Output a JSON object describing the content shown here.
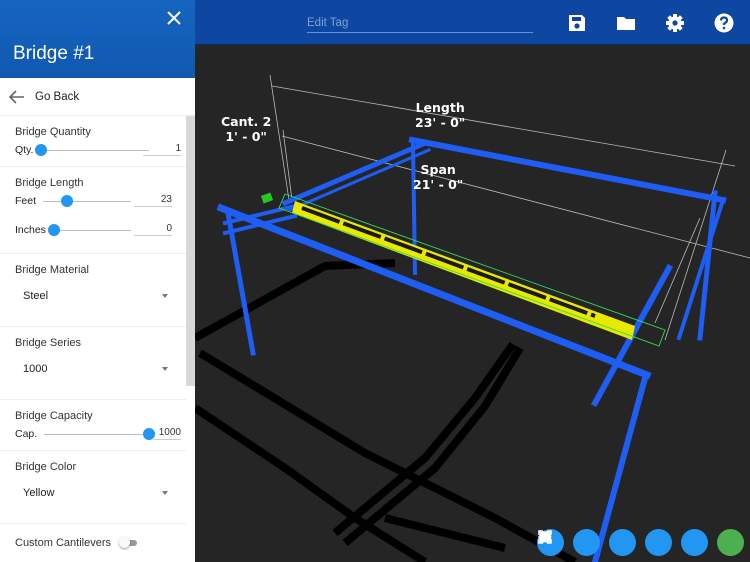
{
  "sidebar": {
    "title": "Bridge #1",
    "close_icon": "close-icon",
    "go_back": "Go Back",
    "sections": {
      "quantity": {
        "title": "Bridge Quantity",
        "label": "Qty.",
        "value": "1",
        "fraction": 0.0
      },
      "length": {
        "title": "Bridge Length",
        "feet": {
          "label": "Feet",
          "value": "23",
          "fraction": 0.22
        },
        "inches": {
          "label": "Inches",
          "value": "0",
          "fraction": 0.0
        }
      },
      "material": {
        "title": "Bridge Material",
        "selected": "Steel"
      },
      "series": {
        "title": "Bridge Series",
        "selected": "1000"
      },
      "capacity": {
        "title": "Bridge Capacity",
        "label": "Cap.",
        "value": "1000",
        "fraction": 1.0
      },
      "color": {
        "title": "Bridge Color",
        "selected": "Yellow"
      },
      "cantilevers": {
        "label": "Custom Cantilevers",
        "enabled": false
      }
    }
  },
  "topbar": {
    "tag_placeholder": "Edit Tag",
    "icons": [
      "save-icon",
      "folder-icon",
      "settings-icon",
      "help-icon"
    ]
  },
  "viewport": {
    "dimensions": {
      "cant2": {
        "name": "Cant. 2",
        "value": "1' - 0\""
      },
      "length": {
        "name": "Length",
        "value": "23' - 0\""
      },
      "span": {
        "name": "Span",
        "value": "21' - 0\""
      }
    },
    "colors": {
      "frame": "#1e5ef5",
      "bridge": "#ffff00",
      "highlight": "#33dd55",
      "background": "#252525"
    },
    "toolbar": [
      "home-view",
      "fit-view",
      "iso-view",
      "side-view",
      "front-view",
      "confirm"
    ]
  }
}
